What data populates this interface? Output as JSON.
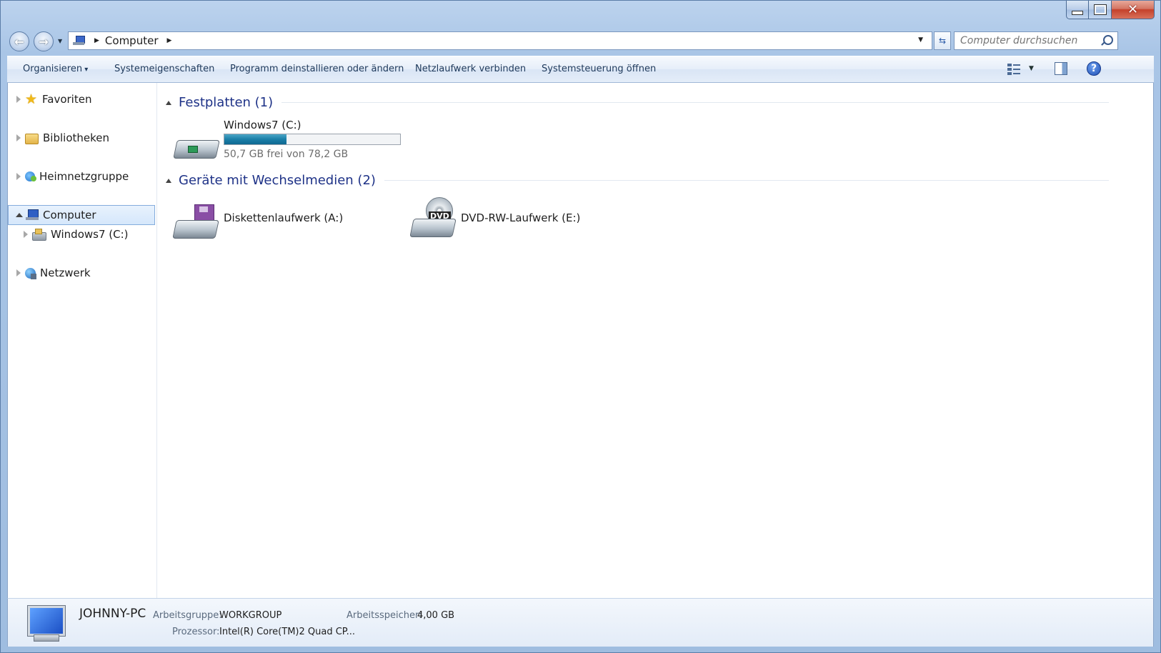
{
  "window": {
    "caption_icons": [
      "minimize-icon",
      "maximize-icon",
      "close-icon"
    ]
  },
  "navigation": {
    "address_text": "Computer",
    "search_placeholder": "Computer durchsuchen"
  },
  "toolbar": {
    "organize_label": "Organisieren",
    "system_properties_label": "Systemeigenschaften",
    "uninstall_label": "Programm deinstallieren oder ändern",
    "map_drive_label": "Netzlaufwerk verbinden",
    "control_panel_label": "Systemsteuerung öffnen"
  },
  "navpane": {
    "items": [
      {
        "label": "Favoriten",
        "icon": "star-icon"
      },
      {
        "label": "Bibliotheken",
        "icon": "libraries-icon"
      },
      {
        "label": "Heimnetzgruppe",
        "icon": "homegroup-icon"
      },
      {
        "label": "Computer",
        "icon": "computer-icon"
      },
      {
        "label": "Windows7 (C:)",
        "icon": "drive-icon"
      },
      {
        "label": "Netzwerk",
        "icon": "network-icon"
      }
    ]
  },
  "main": {
    "hard_disks_header": "Festplatten (1)",
    "removable_header": "Geräte mit Wechselmedien (2)",
    "drive_c": {
      "name": "Windows7 (C:)",
      "space_text": "50,7 GB frei von 78,2 GB",
      "used_fraction": 0.352
    },
    "drive_a": {
      "name": "Diskettenlaufwerk (A:)"
    },
    "drive_e": {
      "name": "DVD-RW-Laufwerk (E:)",
      "badge": "DVD"
    }
  },
  "details": {
    "pc_name": "JOHNNY-PC",
    "workgroup_label": "Arbeitsgruppe:",
    "workgroup_value": "WORKGROUP",
    "memory_label": "Arbeitsspeicher:",
    "memory_value": "4,00 GB",
    "processor_label": "Prozessor:",
    "processor_value": "Intel(R) Core(TM)2 Quad CP..."
  },
  "colors": {
    "group_title": "#1e3287",
    "usage_bar": "#1b7fa8",
    "selection_border": "#84acdd"
  }
}
